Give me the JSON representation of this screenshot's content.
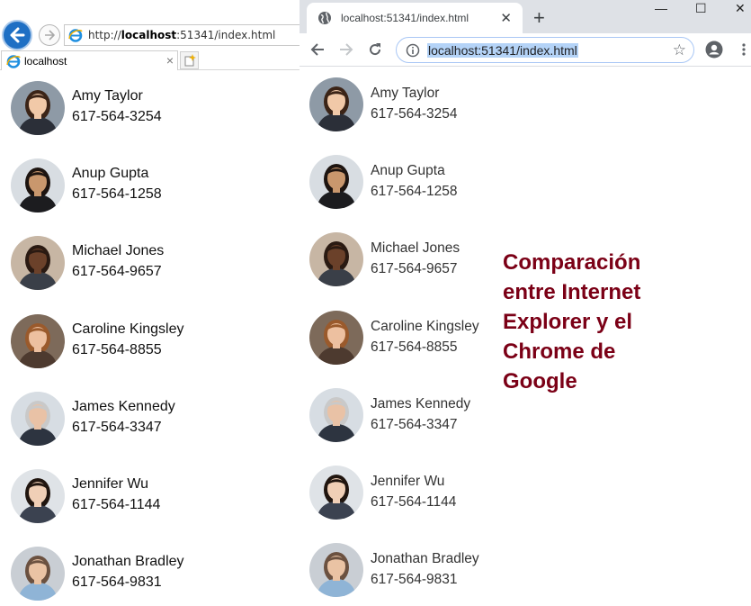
{
  "ie": {
    "url_prefix": "http://",
    "url_host": "localhost",
    "url_rest": ":51341/index.html",
    "tab_title": "localhost",
    "tab_close": "×"
  },
  "chrome": {
    "tab_title": "localhost:51341/index.html",
    "tab_close": "✕",
    "new_tab": "+",
    "url": "localhost:51341/index.html",
    "star": "☆",
    "minimize": "—",
    "maximize": "☐",
    "close": "✕"
  },
  "contacts": [
    {
      "name": "Amy Taylor",
      "phone": "617-564-3254",
      "skin": "#f1c9a8",
      "hair": "#3b2417",
      "shirt": "#2b2f38",
      "bg": "#8e9aa6"
    },
    {
      "name": "Anup Gupta",
      "phone": "617-564-1258",
      "skin": "#c9976d",
      "hair": "#1d1410",
      "shirt": "#1c1c1f",
      "bg": "#d8dde2"
    },
    {
      "name": "Michael Jones",
      "phone": "617-564-9657",
      "skin": "#6b412a",
      "hair": "#2a1a12",
      "shirt": "#3a3f48",
      "bg": "#c7b6a4"
    },
    {
      "name": "Caroline Kingsley",
      "phone": "617-564-8855",
      "skin": "#edc0a0",
      "hair": "#9a5a2c",
      "shirt": "#4d3a2f",
      "bg": "#7d6a5a"
    },
    {
      "name": "James Kennedy",
      "phone": "617-564-3347",
      "skin": "#e9c2a6",
      "hair": "#c9c9c9",
      "shirt": "#2d3440",
      "bg": "#d7dde3"
    },
    {
      "name": "Jennifer Wu",
      "phone": "617-564-1144",
      "skin": "#f0cfb6",
      "hair": "#20150f",
      "shirt": "#3b4250",
      "bg": "#dfe3e7"
    },
    {
      "name": "Jonathan Bradley",
      "phone": "617-564-9831",
      "skin": "#eac3a4",
      "hair": "#6b5140",
      "shirt": "#8fb4d6",
      "bg": "#c9ced4"
    }
  ],
  "caption_lines": [
    "Comparación",
    "entre Internet",
    "Explorer y el",
    "Chrome de",
    "Google"
  ],
  "colors": {
    "caption": "#7b0016",
    "ie_back": "#1e6fc4",
    "url_highlight": "#b4d3f7"
  }
}
